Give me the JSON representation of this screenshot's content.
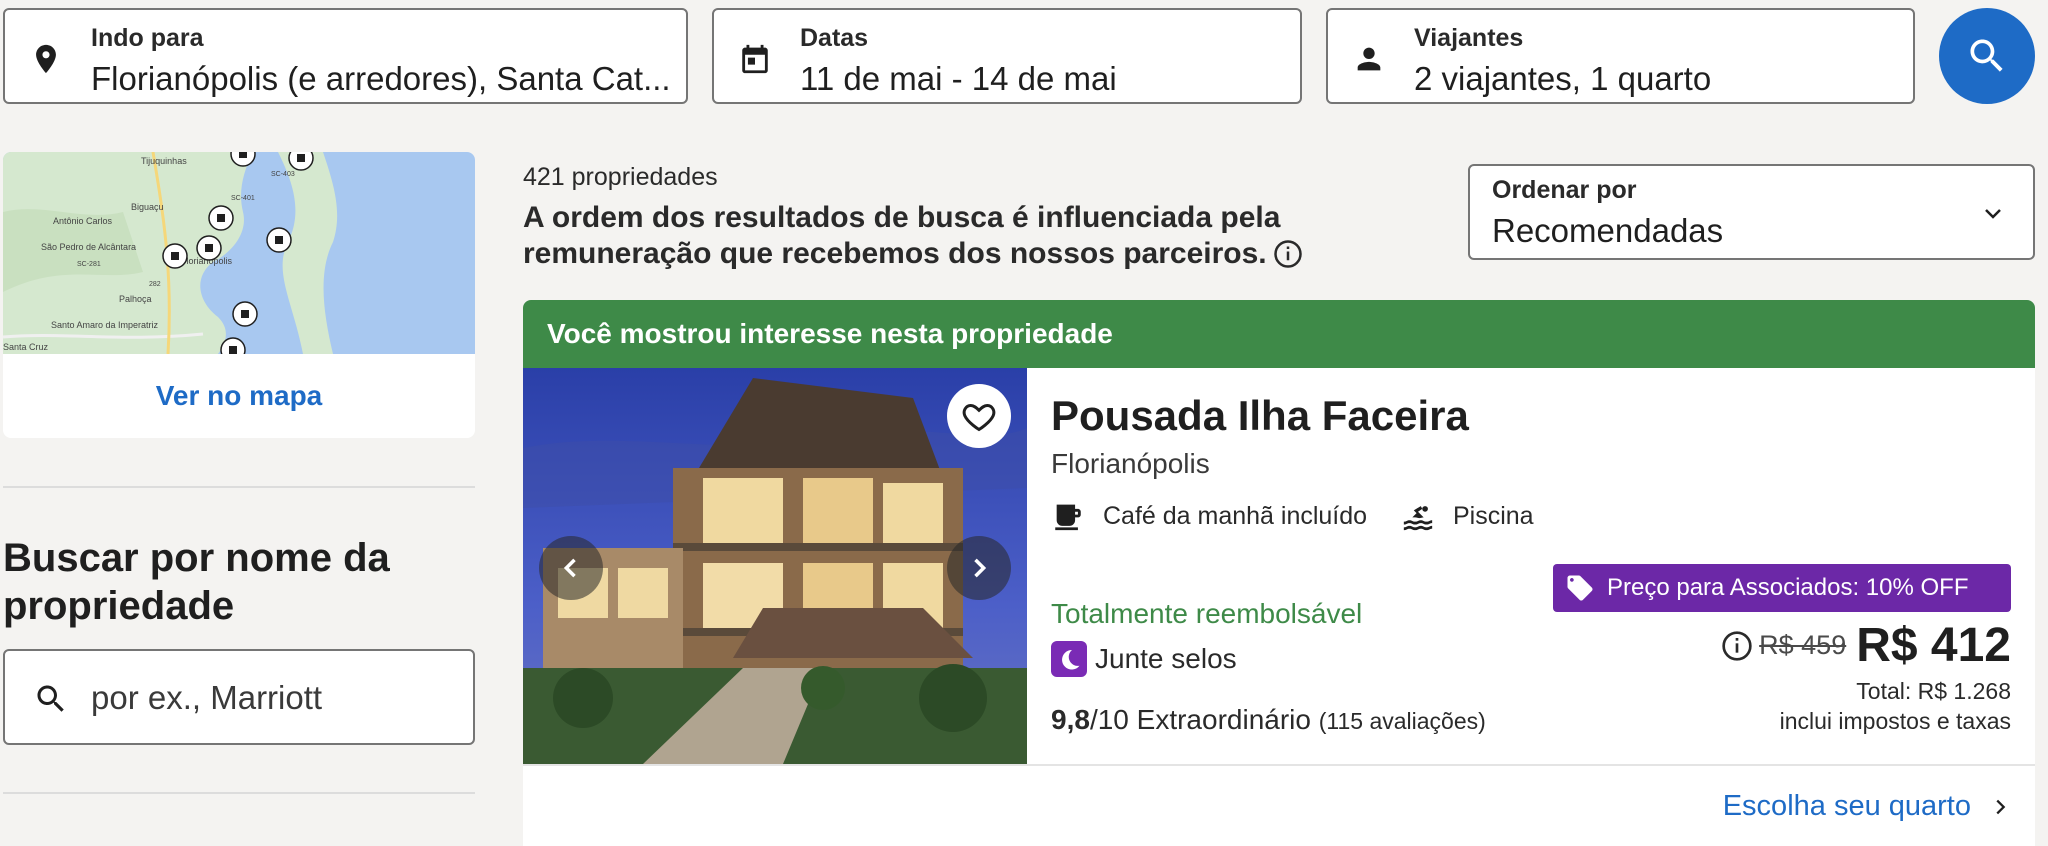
{
  "search": {
    "destination": {
      "label": "Indo para",
      "value": "Florianópolis (e arredores), Santa Cat..."
    },
    "dates": {
      "label": "Datas",
      "value": "11 de mai - 14 de mai"
    },
    "travelers": {
      "label": "Viajantes",
      "value": "2 viajantes, 1 quarto"
    }
  },
  "sidebar": {
    "map": {
      "link_label": "Ver no mapa",
      "place_labels": [
        "Tijuquinhas",
        "Biguaçu",
        "Antônio Carlos",
        "São Pedro de Alcântara",
        "Florianópolis",
        "Palhoça",
        "Santo Amaro da Imperatriz",
        "Santa Cruz"
      ],
      "road_labels": [
        "SC-401",
        "SC-403",
        "SC-281",
        "282"
      ]
    },
    "name_search": {
      "title": "Buscar por nome da propriedade",
      "placeholder": "por ex., Marriott"
    }
  },
  "results": {
    "count": "421 propriedades",
    "disclaimer": "A ordem dos resultados de busca é influenciada pela remuneração que recebemos dos nossos parceiros.",
    "sort": {
      "label": "Ordenar por",
      "value": "Recomendadas"
    }
  },
  "property": {
    "banner": "Você mostrou interesse nesta propriedade",
    "name": "Pousada Ilha Faceira",
    "city": "Florianópolis",
    "amenities": [
      {
        "label": "Café da manhã incluído",
        "icon": "coffee-icon"
      },
      {
        "label": "Piscina",
        "icon": "pool-icon"
      }
    ],
    "refundable": "Totalmente reembolsável",
    "stamps": "Junte selos",
    "rating": {
      "score": "9,8",
      "scale": "/10",
      "label": "Extraordinário",
      "reviews": "(115 avaliações)"
    },
    "member_badge": "Preço para Associados: 10% OFF",
    "old_price": "R$ 459",
    "price": "R$ 412",
    "total": "Total: R$ 1.268",
    "taxes": "inclui impostos e taxas",
    "cta": "Escolha seu quarto"
  },
  "colors": {
    "primary": "#1e6bc6",
    "banner_green": "#3e8a48",
    "member_purple": "#6c28a7",
    "refundable_green": "#3e8a48"
  }
}
